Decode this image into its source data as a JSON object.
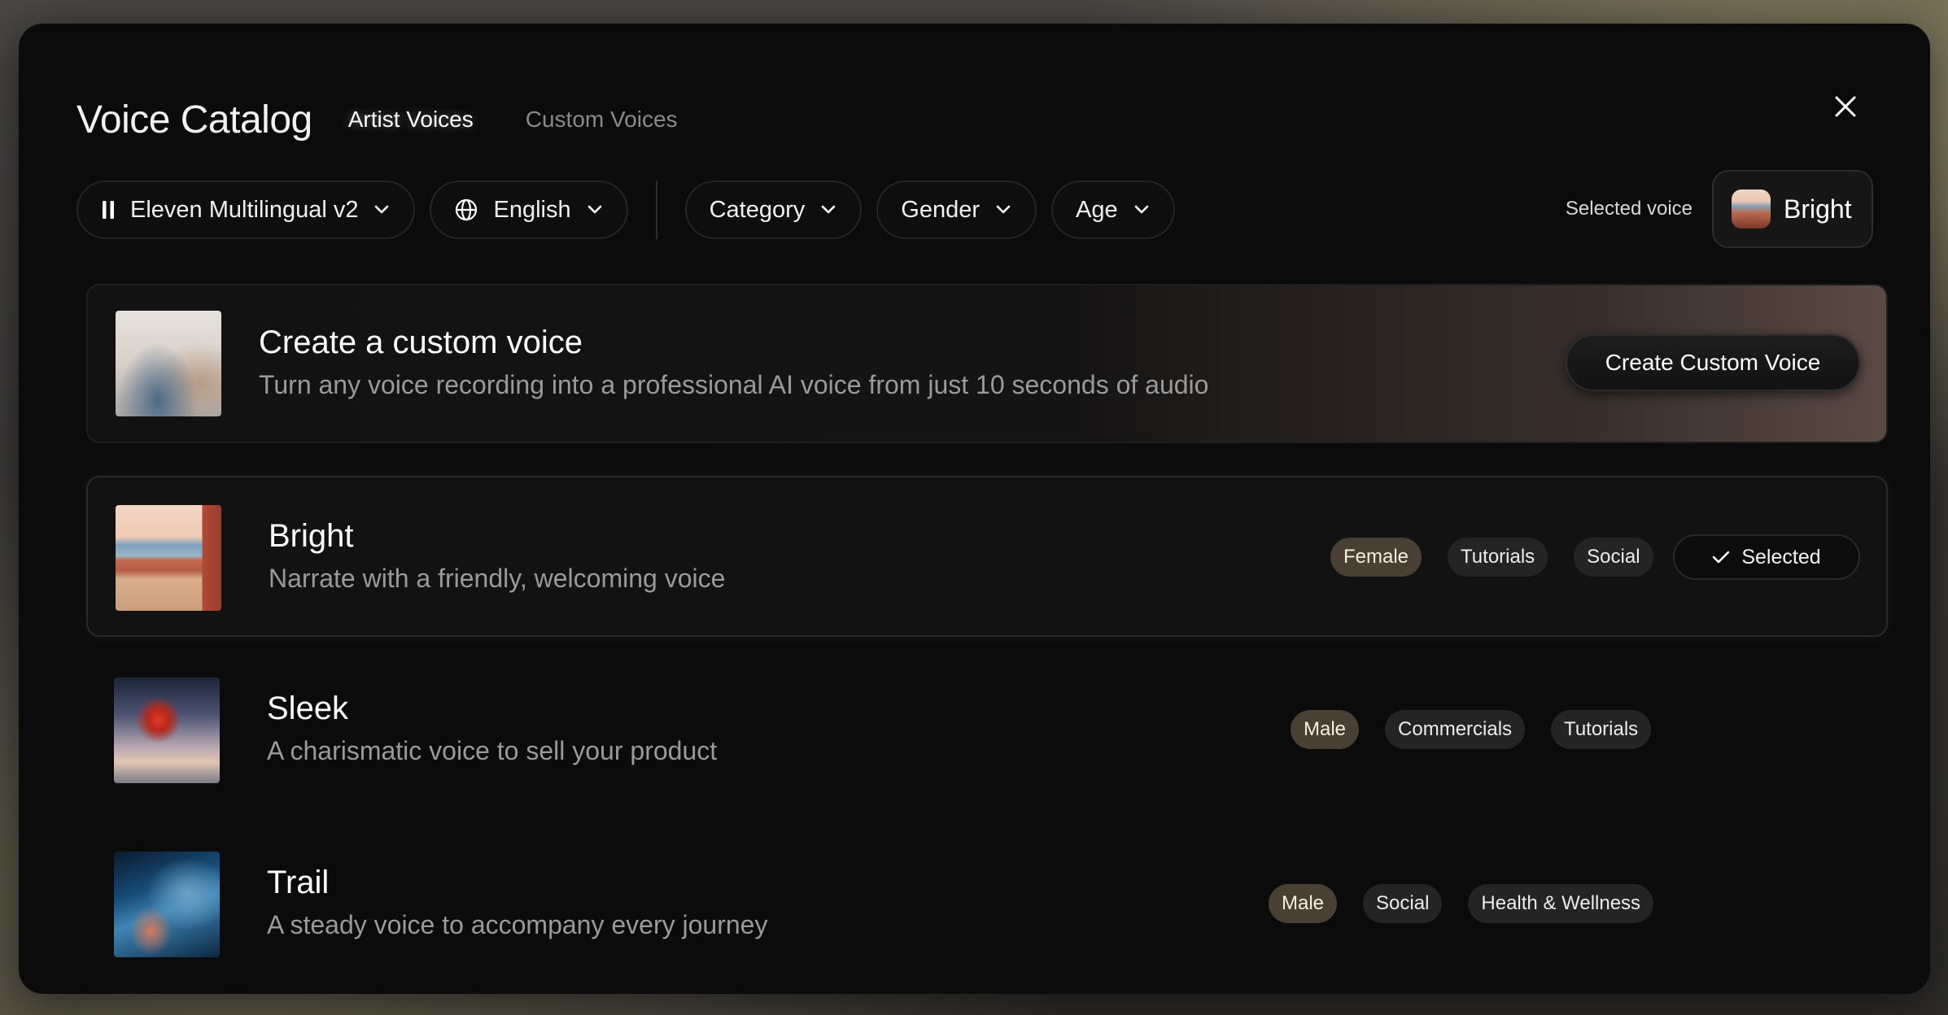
{
  "header": {
    "title": "Voice Catalog",
    "tabs": [
      {
        "label": "Artist Voices",
        "active": true
      },
      {
        "label": "Custom Voices",
        "active": false
      }
    ],
    "close_icon": "close-icon"
  },
  "filters": {
    "model": {
      "label": "Eleven Multilingual v2",
      "icon": "pause-icon"
    },
    "language": {
      "label": "English",
      "icon": "globe-icon"
    },
    "category": {
      "label": "Category"
    },
    "gender": {
      "label": "Gender"
    },
    "age": {
      "label": "Age"
    }
  },
  "selected_voice": {
    "label": "Selected voice",
    "name": "Bright"
  },
  "create_custom": {
    "title": "Create a custom voice",
    "subtitle": "Turn any voice recording into a professional AI voice from just 10 seconds of audio",
    "button_label": "Create Custom Voice"
  },
  "voices": [
    {
      "name": "Bright",
      "description": "Narrate with a friendly, welcoming voice",
      "tags": [
        "Female",
        "Tutorials",
        "Social"
      ],
      "selected": true,
      "selected_label": "Selected"
    },
    {
      "name": "Sleek",
      "description": "A charismatic voice to sell your product",
      "tags": [
        "Male",
        "Commercials",
        "Tutorials"
      ],
      "selected": false
    },
    {
      "name": "Trail",
      "description": "A steady voice to accompany every journey",
      "tags": [
        "Male",
        "Social",
        "Health & Wellness"
      ],
      "selected": false
    }
  ],
  "colors": {
    "modal_bg": "#0b0b0b",
    "gender_tag_bg": "#4a3f33",
    "tag_bg": "#242424",
    "text_primary": "#ffffff",
    "text_secondary": "#9a9a9a"
  }
}
